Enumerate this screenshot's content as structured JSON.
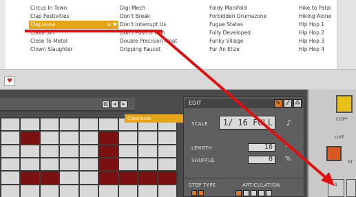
{
  "browser": {
    "columns": [
      {
        "items": [
          {
            "label": "Circus In Town"
          },
          {
            "label": "Clap Festivities"
          },
          {
            "label": "Claplause",
            "selected": true
          },
          {
            "label": "Clave Sin"
          },
          {
            "label": "Close To Metal"
          },
          {
            "label": "Clown Slaughter"
          }
        ]
      },
      {
        "items": [
          {
            "label": "Digi Mech"
          },
          {
            "label": "Don't Break"
          },
          {
            "label": "Don't Interrupt Us"
          },
          {
            "label": "Don't Push It Man"
          },
          {
            "label": "Double Precision Float"
          },
          {
            "label": "Dripping Faucet"
          }
        ]
      },
      {
        "items": [
          {
            "label": "Foldy Manifold"
          },
          {
            "label": "Forbidden Drumazone"
          },
          {
            "label": "Fugue States"
          },
          {
            "label": "Fully Developed"
          },
          {
            "label": "Funky Village"
          },
          {
            "label": "Fur An Elize"
          }
        ]
      },
      {
        "items": [
          {
            "label": "Hike to Patai"
          },
          {
            "label": "Hiking Alone"
          },
          {
            "label": "Hip Hop 1"
          },
          {
            "label": "Hip Hop 2"
          },
          {
            "label": "Hip Hop 3"
          },
          {
            "label": "Hip Hop 4"
          }
        ]
      }
    ],
    "heart_glyph": "♥"
  },
  "sequencer": {
    "nav_glyphs": [
      "▤",
      "◂",
      "▸"
    ],
    "grid_rows": [
      [
        0,
        0,
        0,
        0,
        0,
        0,
        0,
        0,
        0
      ],
      [
        0,
        1,
        0,
        0,
        0,
        1,
        0,
        0,
        0
      ],
      [
        0,
        0,
        0,
        0,
        0,
        1,
        0,
        0,
        0
      ],
      [
        0,
        0,
        0,
        0,
        0,
        1,
        0,
        0,
        0
      ],
      [
        0,
        1,
        1,
        0,
        0,
        1,
        1,
        1,
        1
      ],
      [
        0,
        0,
        0,
        0,
        0,
        0,
        0,
        0,
        0
      ]
    ],
    "drag_chip": "Claplause"
  },
  "edit": {
    "title": "EDIT",
    "scale_label": "SCALE",
    "scale_value": "1/ 16 FULL",
    "scale_aux": "♪",
    "length_label": "LENGTH",
    "length_value": "16",
    "shuffle_label": "SHUFFLE",
    "shuffle_value": "0",
    "step_type_label": "STEP TYPE",
    "articulation_label": "ARTICULATION",
    "icons": [
      "✎",
      "⁄⁄",
      "⁂"
    ]
  },
  "right": {
    "copy_label": "COPY",
    "live_label": "LIVE",
    "st_label": "ST",
    "step_btn_label": "1"
  },
  "colors": {
    "selection": "#e6a419",
    "step_on": "#7b1010",
    "arrow": "#e01010"
  }
}
